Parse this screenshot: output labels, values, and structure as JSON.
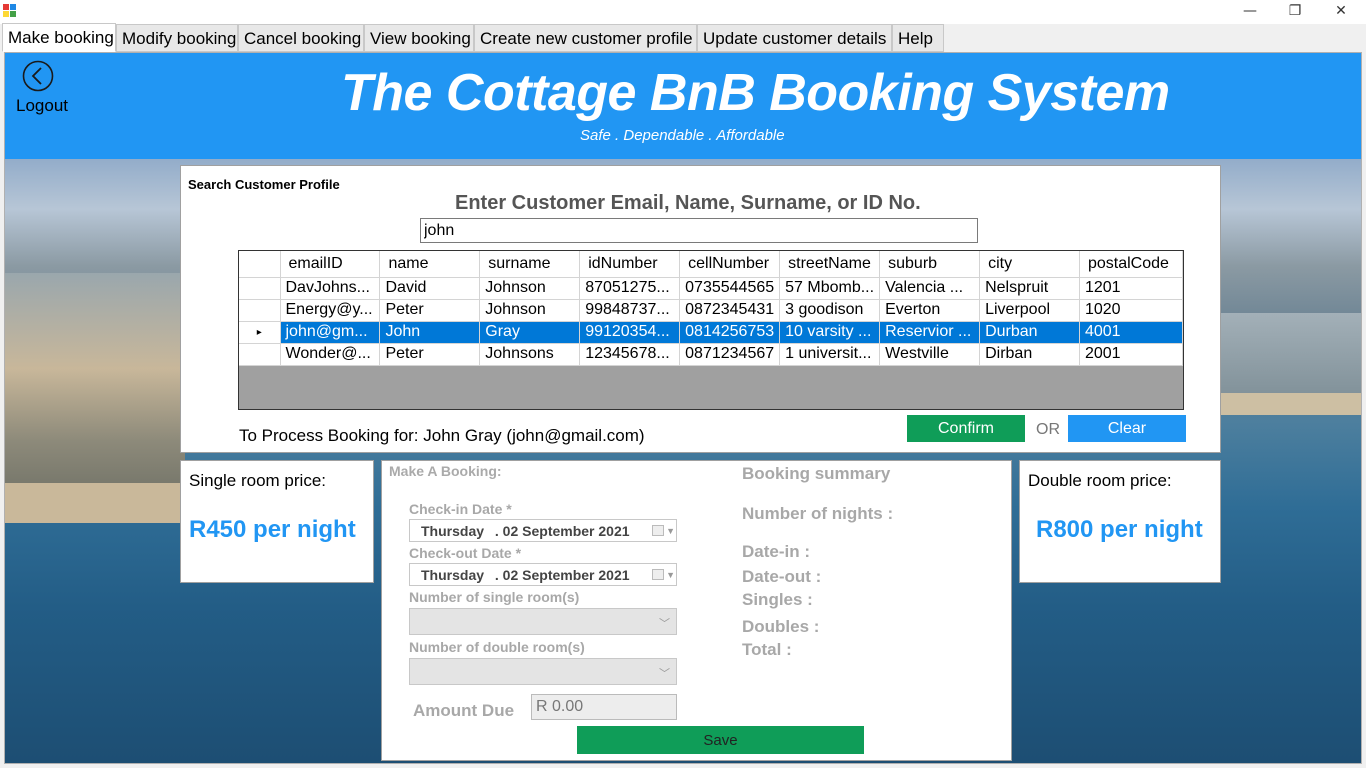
{
  "window": {
    "minimize": "—",
    "restore": "❐",
    "close": "✕"
  },
  "menu": {
    "tabs": [
      {
        "label": "Make booking"
      },
      {
        "label": "Modify booking"
      },
      {
        "label": "Cancel booking"
      },
      {
        "label": "View booking"
      },
      {
        "label": "Create new customer profile"
      },
      {
        "label": "Update customer details"
      },
      {
        "label": "Help"
      }
    ],
    "active_tab": "Make booking"
  },
  "header": {
    "logout_label": "Logout",
    "title": "The Cottage BnB Booking System",
    "tagline": "Safe . Dependable . Affordable",
    "color": "#2196f3"
  },
  "search": {
    "panel_title": "Search Customer Profile",
    "prompt": "Enter Customer Email, Name, Surname, or ID No.",
    "query": "john"
  },
  "grid": {
    "columns": [
      "emailID",
      "name",
      "surname",
      "idNumber",
      "cellNumber",
      "streetName",
      "suburb",
      "city",
      "postalCode"
    ],
    "rows": [
      [
        "DavJohns...",
        "David",
        "Johnson",
        "87051275...",
        "0735544565",
        "57 Mbomb...",
        "Valencia ...",
        "Nelspruit",
        "1201"
      ],
      [
        "Energy@y...",
        "Peter",
        "Johnson",
        "99848737...",
        "0872345431",
        "3 goodison",
        "Everton",
        "Liverpool",
        "1020"
      ],
      [
        "john@gm...",
        "John",
        "Gray",
        "99120354...",
        "0814256753",
        "10 varsity ...",
        "Reservior ...",
        "Durban",
        "4001"
      ],
      [
        "Wonder@...",
        "Peter",
        "Johnsons",
        "12345678...",
        "0871234567",
        "1 universit...",
        "Westville",
        "Dirban",
        "2001"
      ]
    ],
    "selected_row": 2,
    "row_pointer": "▸"
  },
  "process": {
    "label": "To Process Booking for: John Gray (john@gmail.com)",
    "confirm_label": "Confirm",
    "or_label": "OR",
    "clear_label": "Clear"
  },
  "prices": {
    "single_label": "Single room price:",
    "single_value": "R450 per night",
    "double_label": "Double room price:",
    "double_value": "R800 per night"
  },
  "booking": {
    "title": "Make A Booking:",
    "checkin_label": "Check-in Date *",
    "checkin_day": "Thursday",
    "checkin_date": ". 02 September 2021",
    "checkout_label": "Check-out Date *",
    "checkout_day": "Thursday",
    "checkout_date": ". 02 September 2021",
    "single_rooms_label": "Number of single room(s)",
    "double_rooms_label": "Number of double room(s)",
    "amount_label": "Amount Due",
    "amount_value": "R 0.00",
    "save_label": "Save"
  },
  "summary": {
    "title": "Booking summary",
    "nights": "Number of nights :",
    "date_in": "Date-in :",
    "date_out": "Date-out :",
    "singles": "Singles :",
    "doubles": "Doubles :",
    "total": "Total :"
  },
  "colors": {
    "accent_blue": "#2196f3",
    "confirm_green": "#0f9d58",
    "selection": "#0078d7"
  }
}
